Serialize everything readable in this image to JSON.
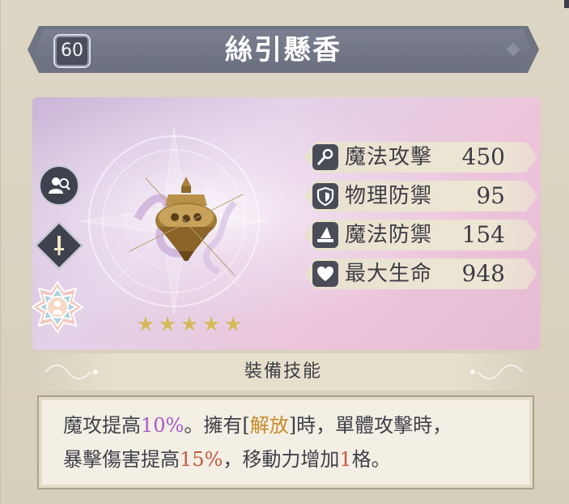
{
  "item": {
    "level": "60",
    "name": "絲引懸香",
    "rarity_stars": 5
  },
  "stats": [
    {
      "icon": "wand-icon",
      "label": "魔法攻擊",
      "value": "450"
    },
    {
      "icon": "shield-icon",
      "label": "物理防禦",
      "value": "95"
    },
    {
      "icon": "witch-hat-icon",
      "label": "魔法防禦",
      "value": "154"
    },
    {
      "icon": "heart-icon",
      "label": "最大生命",
      "value": "948"
    }
  ],
  "side_icons": [
    "character-search-icon",
    "sword-icon",
    "class-emblem-icon"
  ],
  "skill": {
    "header": "裝備技能",
    "line1": {
      "p1": "魔攻提高",
      "h1": "10%",
      "p2": "。擁有[",
      "h2": "解放",
      "p3": "]時，單體攻擊時，"
    },
    "line2": {
      "p1": "暴擊傷害提高",
      "h1": "15%",
      "p2": "，移動力增加",
      "h2": "1",
      "p3": "格。"
    }
  },
  "colors": {
    "highlight_purple": "#a65bc6",
    "highlight_gold": "#c88a2a",
    "highlight_red": "#c25a42",
    "banner": "#6f7482"
  }
}
